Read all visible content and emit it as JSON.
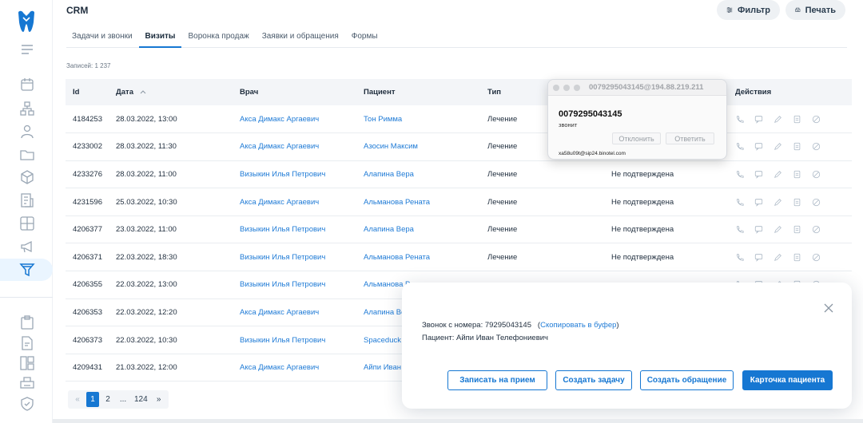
{
  "app": {
    "title": "CRM",
    "brand_color": "#1677d2"
  },
  "toolbar": {
    "filter_label": "Фильтр",
    "print_label": "Печать"
  },
  "tabs": [
    {
      "label": "Задачи и звонки",
      "active": false
    },
    {
      "label": "Визиты",
      "active": true
    },
    {
      "label": "Воронка продаж",
      "active": false
    },
    {
      "label": "Заявки и обращения",
      "active": false
    },
    {
      "label": "Формы",
      "active": false
    }
  ],
  "records": {
    "label": "Записей: 1 237"
  },
  "table": {
    "columns": {
      "id": "Id",
      "date": "Дата",
      "doctor": "Врач",
      "patient": "Пациент",
      "type": "Тип",
      "status": "",
      "actions": "Действия"
    },
    "rows": [
      {
        "id": "4184253",
        "date": "28.03.2022, 13:00",
        "doctor": "Акса Димакс Аргаевич",
        "patient": "Тон Римма",
        "type": "Лечение",
        "status": ""
      },
      {
        "id": "4233002",
        "date": "28.03.2022, 11:30",
        "doctor": "Акса Димакс Аргаевич",
        "patient": "Азосин Максим",
        "type": "Лечение",
        "status": ""
      },
      {
        "id": "4233276",
        "date": "28.03.2022, 11:00",
        "doctor": "Визыкин Илья Петрович",
        "patient": "Алапина Вера",
        "type": "Лечение",
        "status": "Не подтверждена"
      },
      {
        "id": "4231596",
        "date": "25.03.2022, 10:30",
        "doctor": "Акса Димакс Аргаевич",
        "patient": "Альманова Рената",
        "type": "Лечение",
        "status": "Не подтверждена"
      },
      {
        "id": "4206377",
        "date": "23.03.2022, 11:00",
        "doctor": "Визыкин Илья Петрович",
        "patient": "Алапина Вера",
        "type": "Лечение",
        "status": "Не подтверждена"
      },
      {
        "id": "4206371",
        "date": "22.03.2022, 18:30",
        "doctor": "Визыкин Илья Петрович",
        "patient": "Альманова Рената",
        "type": "Лечение",
        "status": "Не подтверждена"
      },
      {
        "id": "4206355",
        "date": "22.03.2022, 13:00",
        "doctor": "Визыкин Илья Петрович",
        "patient": "Альманова Р",
        "type": "",
        "status": ""
      },
      {
        "id": "4206353",
        "date": "22.03.2022, 12:20",
        "doctor": "Акса Димакс Аргаевич",
        "patient": "Алапина Ве",
        "type": "",
        "status": ""
      },
      {
        "id": "4206373",
        "date": "22.03.2022, 10:30",
        "doctor": "Визыкин Илья Петрович",
        "patient": "Spaceduck",
        "type": "",
        "status": ""
      },
      {
        "id": "4209431",
        "date": "21.03.2022, 12:00",
        "doctor": "Акса Димакс Аргаевич",
        "patient": "Айпи Иван",
        "type": "",
        "status": ""
      }
    ]
  },
  "pagination": {
    "prev": "«",
    "pages": [
      "1",
      "2",
      "...",
      "124"
    ],
    "next": "»",
    "current": "1"
  },
  "softphone": {
    "title": "0079295043145@194.88.219.211",
    "number": "0079295043145",
    "state": "звонит",
    "decline_label": "Отклонить",
    "answer_label": "Ответить",
    "sip": "xa58u09t@sip24.binotel.com"
  },
  "call_modal": {
    "line1_prefix": "Звонок с номера: 79295043145",
    "copy_open": "(",
    "copy_link": "Скопировать в буфер",
    "copy_close": ")",
    "line2": "Пациент: Айпи Иван Телефониевич",
    "btn_appointment": "Записать на прием",
    "btn_task": "Создать задачу",
    "btn_request": "Создать обращение",
    "btn_card": "Карточка пациента"
  }
}
